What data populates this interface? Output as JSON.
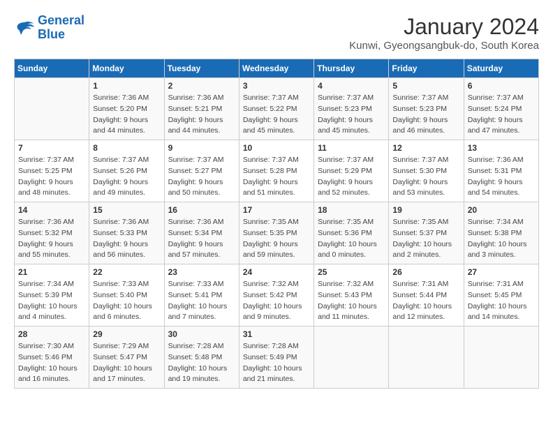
{
  "header": {
    "logo_line1": "General",
    "logo_line2": "Blue",
    "main_title": "January 2024",
    "subtitle": "Kunwi, Gyeongsangbuk-do, South Korea"
  },
  "weekdays": [
    "Sunday",
    "Monday",
    "Tuesday",
    "Wednesday",
    "Thursday",
    "Friday",
    "Saturday"
  ],
  "weeks": [
    [
      {
        "day": "",
        "info": ""
      },
      {
        "day": "1",
        "info": "Sunrise: 7:36 AM\nSunset: 5:20 PM\nDaylight: 9 hours\nand 44 minutes."
      },
      {
        "day": "2",
        "info": "Sunrise: 7:36 AM\nSunset: 5:21 PM\nDaylight: 9 hours\nand 44 minutes."
      },
      {
        "day": "3",
        "info": "Sunrise: 7:37 AM\nSunset: 5:22 PM\nDaylight: 9 hours\nand 45 minutes."
      },
      {
        "day": "4",
        "info": "Sunrise: 7:37 AM\nSunset: 5:23 PM\nDaylight: 9 hours\nand 45 minutes."
      },
      {
        "day": "5",
        "info": "Sunrise: 7:37 AM\nSunset: 5:23 PM\nDaylight: 9 hours\nand 46 minutes."
      },
      {
        "day": "6",
        "info": "Sunrise: 7:37 AM\nSunset: 5:24 PM\nDaylight: 9 hours\nand 47 minutes."
      }
    ],
    [
      {
        "day": "7",
        "info": "Sunrise: 7:37 AM\nSunset: 5:25 PM\nDaylight: 9 hours\nand 48 minutes."
      },
      {
        "day": "8",
        "info": "Sunrise: 7:37 AM\nSunset: 5:26 PM\nDaylight: 9 hours\nand 49 minutes."
      },
      {
        "day": "9",
        "info": "Sunrise: 7:37 AM\nSunset: 5:27 PM\nDaylight: 9 hours\nand 50 minutes."
      },
      {
        "day": "10",
        "info": "Sunrise: 7:37 AM\nSunset: 5:28 PM\nDaylight: 9 hours\nand 51 minutes."
      },
      {
        "day": "11",
        "info": "Sunrise: 7:37 AM\nSunset: 5:29 PM\nDaylight: 9 hours\nand 52 minutes."
      },
      {
        "day": "12",
        "info": "Sunrise: 7:37 AM\nSunset: 5:30 PM\nDaylight: 9 hours\nand 53 minutes."
      },
      {
        "day": "13",
        "info": "Sunrise: 7:36 AM\nSunset: 5:31 PM\nDaylight: 9 hours\nand 54 minutes."
      }
    ],
    [
      {
        "day": "14",
        "info": "Sunrise: 7:36 AM\nSunset: 5:32 PM\nDaylight: 9 hours\nand 55 minutes."
      },
      {
        "day": "15",
        "info": "Sunrise: 7:36 AM\nSunset: 5:33 PM\nDaylight: 9 hours\nand 56 minutes."
      },
      {
        "day": "16",
        "info": "Sunrise: 7:36 AM\nSunset: 5:34 PM\nDaylight: 9 hours\nand 57 minutes."
      },
      {
        "day": "17",
        "info": "Sunrise: 7:35 AM\nSunset: 5:35 PM\nDaylight: 9 hours\nand 59 minutes."
      },
      {
        "day": "18",
        "info": "Sunrise: 7:35 AM\nSunset: 5:36 PM\nDaylight: 10 hours\nand 0 minutes."
      },
      {
        "day": "19",
        "info": "Sunrise: 7:35 AM\nSunset: 5:37 PM\nDaylight: 10 hours\nand 2 minutes."
      },
      {
        "day": "20",
        "info": "Sunrise: 7:34 AM\nSunset: 5:38 PM\nDaylight: 10 hours\nand 3 minutes."
      }
    ],
    [
      {
        "day": "21",
        "info": "Sunrise: 7:34 AM\nSunset: 5:39 PM\nDaylight: 10 hours\nand 4 minutes."
      },
      {
        "day": "22",
        "info": "Sunrise: 7:33 AM\nSunset: 5:40 PM\nDaylight: 10 hours\nand 6 minutes."
      },
      {
        "day": "23",
        "info": "Sunrise: 7:33 AM\nSunset: 5:41 PM\nDaylight: 10 hours\nand 7 minutes."
      },
      {
        "day": "24",
        "info": "Sunrise: 7:32 AM\nSunset: 5:42 PM\nDaylight: 10 hours\nand 9 minutes."
      },
      {
        "day": "25",
        "info": "Sunrise: 7:32 AM\nSunset: 5:43 PM\nDaylight: 10 hours\nand 11 minutes."
      },
      {
        "day": "26",
        "info": "Sunrise: 7:31 AM\nSunset: 5:44 PM\nDaylight: 10 hours\nand 12 minutes."
      },
      {
        "day": "27",
        "info": "Sunrise: 7:31 AM\nSunset: 5:45 PM\nDaylight: 10 hours\nand 14 minutes."
      }
    ],
    [
      {
        "day": "28",
        "info": "Sunrise: 7:30 AM\nSunset: 5:46 PM\nDaylight: 10 hours\nand 16 minutes."
      },
      {
        "day": "29",
        "info": "Sunrise: 7:29 AM\nSunset: 5:47 PM\nDaylight: 10 hours\nand 17 minutes."
      },
      {
        "day": "30",
        "info": "Sunrise: 7:28 AM\nSunset: 5:48 PM\nDaylight: 10 hours\nand 19 minutes."
      },
      {
        "day": "31",
        "info": "Sunrise: 7:28 AM\nSunset: 5:49 PM\nDaylight: 10 hours\nand 21 minutes."
      },
      {
        "day": "",
        "info": ""
      },
      {
        "day": "",
        "info": ""
      },
      {
        "day": "",
        "info": ""
      }
    ]
  ]
}
